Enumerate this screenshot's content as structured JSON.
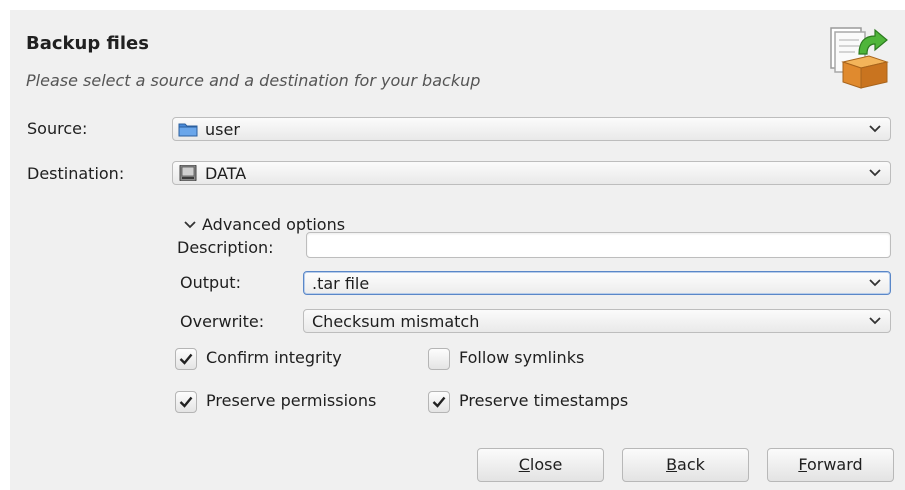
{
  "header": {
    "title": "Backup files",
    "subtitle": "Please select a source and a destination for your backup",
    "icon": "backup-box-icon"
  },
  "source": {
    "label": "Source:",
    "value": "user",
    "icon": "folder-icon"
  },
  "destination": {
    "label": "Destination:",
    "value": "DATA",
    "icon": "drive-icon"
  },
  "advanced": {
    "expander_label": "Advanced options",
    "expanded": true,
    "description": {
      "label": "Description:",
      "value": ""
    },
    "output": {
      "label": "Output:",
      "value": ".tar file"
    },
    "overwrite": {
      "label": "Overwrite:",
      "value": "Checksum mismatch"
    },
    "options": {
      "confirm_integrity": {
        "label": "Confirm integrity",
        "checked": true
      },
      "follow_symlinks": {
        "label": "Follow symlinks",
        "checked": false
      },
      "preserve_permissions": {
        "label": "Preserve permissions",
        "checked": true
      },
      "preserve_timestamps": {
        "label": "Preserve timestamps",
        "checked": true
      }
    }
  },
  "buttons": {
    "close": {
      "mnemonic": "C",
      "rest": "lose"
    },
    "back": {
      "mnemonic": "B",
      "rest": "ack"
    },
    "forward": {
      "mnemonic": "F",
      "rest": "orward"
    }
  },
  "colors": {
    "dialog_bg": "#f0f0f0",
    "focus_border": "#5a87c8",
    "folder_blue": "#4a8ad8",
    "box_orange": "#e08a2e",
    "arrow_green": "#3f9a2f"
  }
}
